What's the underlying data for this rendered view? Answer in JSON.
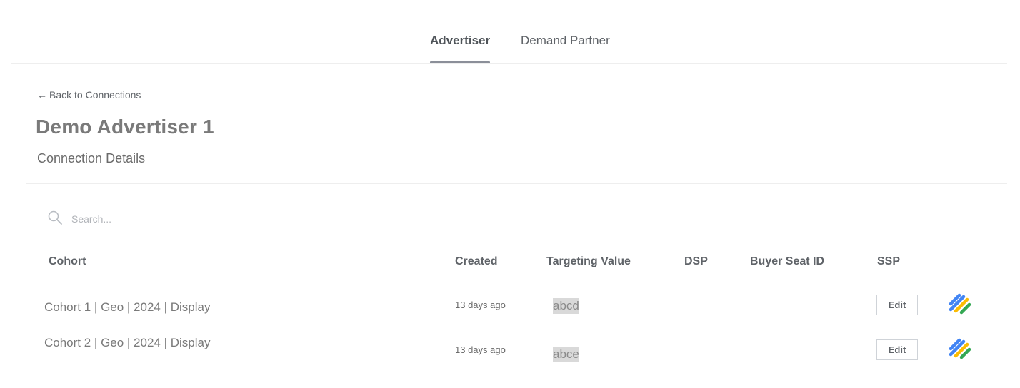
{
  "tabs": [
    {
      "label": "Advertiser",
      "active": true
    },
    {
      "label": "Demand Partner",
      "active": false
    }
  ],
  "back_link": {
    "arrow": "←",
    "label": "Back to Connections"
  },
  "page_title": "Demo Advertiser 1",
  "section_title": "Connection Details",
  "search": {
    "placeholder": "Search..."
  },
  "table": {
    "headers": [
      "Cohort",
      "Created",
      "Targeting Value",
      "DSP",
      "Buyer Seat ID",
      "SSP"
    ],
    "rows": [
      {
        "cohort": "Cohort 1 | Geo | 2024 | Display",
        "created": "13 days ago",
        "targeting_value": "abcd",
        "dsp": "",
        "buyer_seat_id": "",
        "edit_label": "Edit",
        "ssp_icon": "google-ad-manager-icon"
      },
      {
        "cohort": "Cohort 2 | Geo | 2024 | Display",
        "created": "13 days ago",
        "targeting_value": "abce",
        "dsp": "",
        "buyer_seat_id": "",
        "edit_label": "Edit",
        "ssp_icon": "google-ad-manager-icon"
      }
    ]
  },
  "colors": {
    "ssp_blue": "#4285F4",
    "ssp_yellow": "#FBBC04",
    "ssp_green": "#34A853",
    "tab_underline": "#8b8f99"
  }
}
